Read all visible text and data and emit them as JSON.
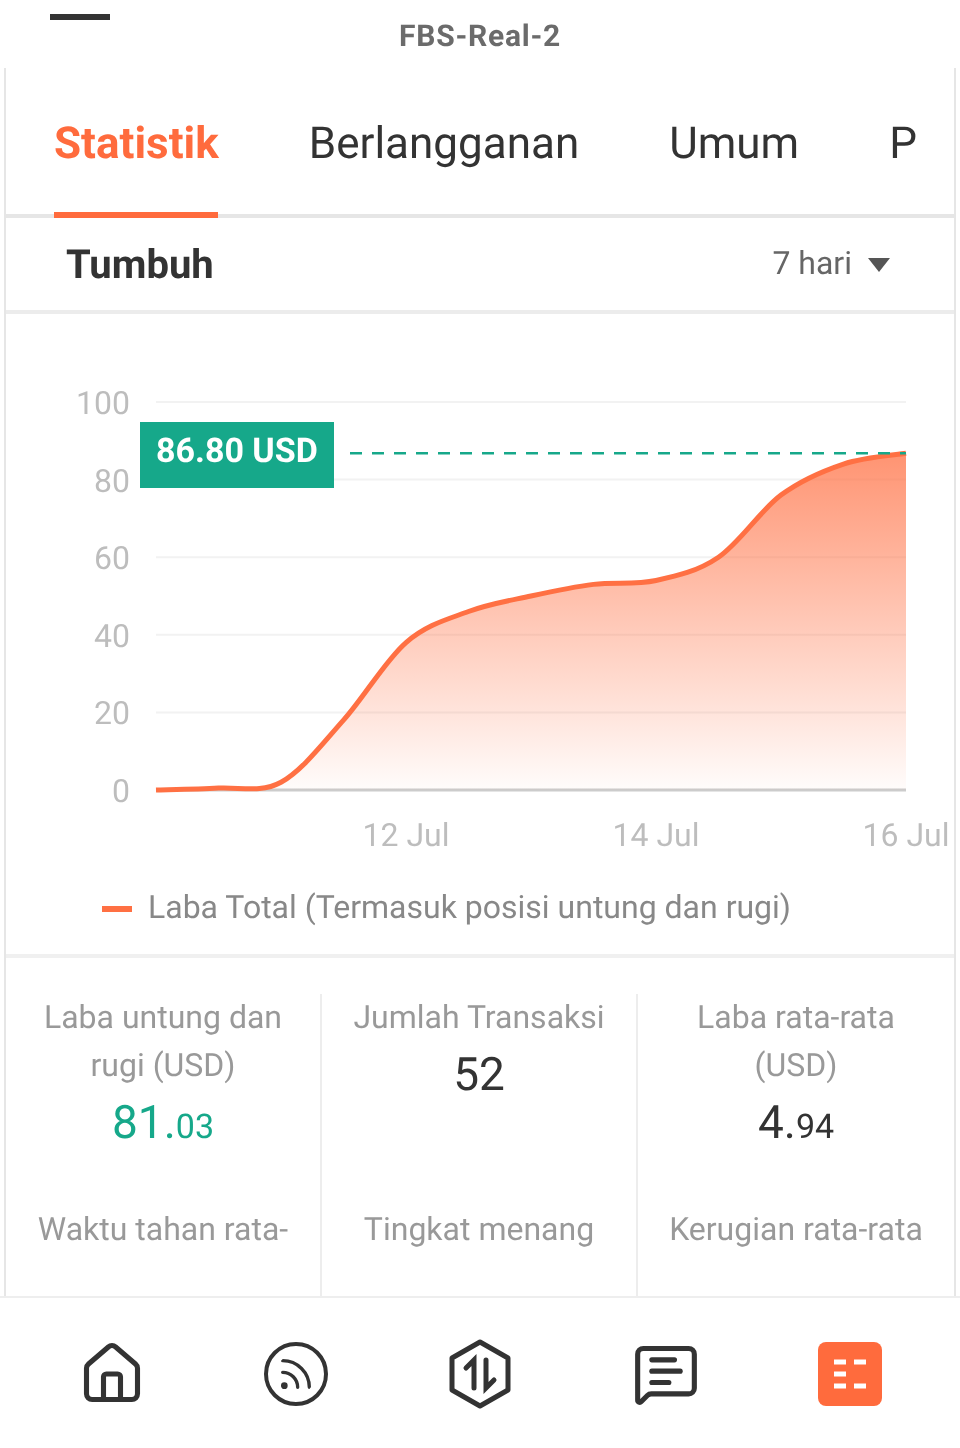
{
  "header": {
    "title": "FBS-Real-2"
  },
  "tabs": [
    {
      "label": "Statistik",
      "selected": true
    },
    {
      "label": "Berlangganan",
      "selected": false
    },
    {
      "label": "Umum",
      "selected": false
    },
    {
      "label": "P",
      "selected": false
    }
  ],
  "growth": {
    "title": "Tumbuh",
    "period": "7 hari",
    "chart_data": {
      "type": "area",
      "categories": [
        null,
        null,
        null,
        null,
        "12 Jul",
        null,
        null,
        null,
        "14 Jul",
        null,
        null,
        null,
        "16 Jul"
      ],
      "series": [
        {
          "name": "Laba Total (Termasuk posisi untung dan rugi)",
          "color": "#ff7043",
          "values": [
            0,
            0.5,
            2,
            18,
            38,
            46,
            50,
            53,
            54,
            60,
            76,
            84,
            86.8
          ]
        }
      ],
      "ylim": [
        0,
        100
      ],
      "grid": true,
      "yticks": [
        0,
        20,
        40,
        60,
        80,
        100
      ],
      "annotations": [
        "86.80 USD"
      ]
    }
  },
  "stats": [
    {
      "label": "Laba untung dan rugi (USD)",
      "value": "81.03",
      "color": "#16a88a"
    },
    {
      "label": "Jumlah Transaksi",
      "value": "52",
      "color": "#333333"
    },
    {
      "label": "Laba rata-rata (USD)",
      "value": "4.94",
      "color": "#333333"
    },
    {
      "label": "Waktu tahan rata-"
    },
    {
      "label": "Tingkat menang"
    },
    {
      "label": "Kerugian rata-rata"
    }
  ]
}
